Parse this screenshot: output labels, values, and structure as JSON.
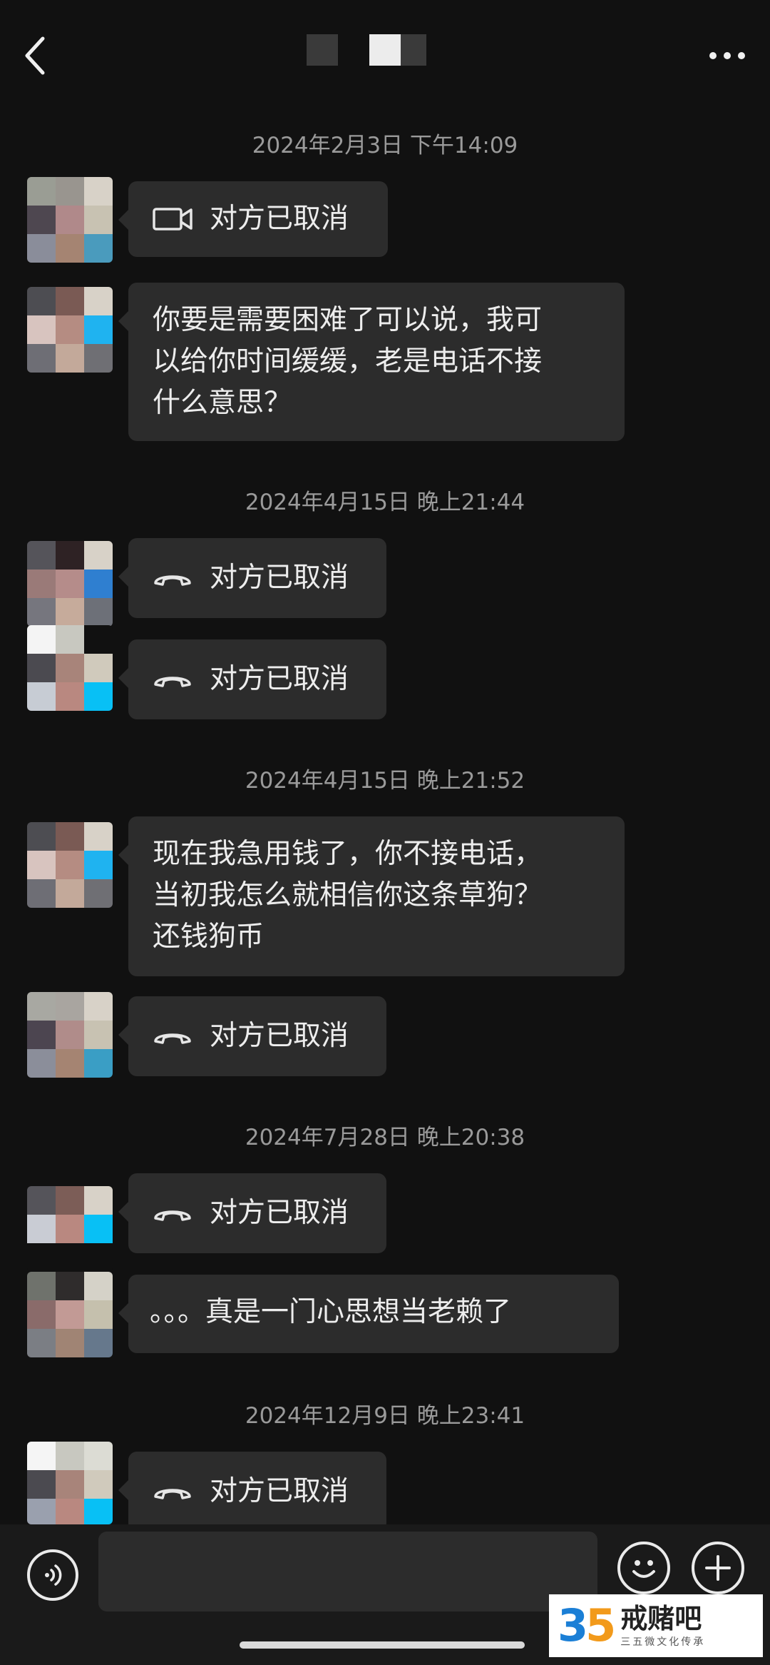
{
  "header": {
    "back_icon": "chevron-left-icon",
    "more_icon": "more-dots-icon"
  },
  "messages": [
    {
      "type": "timestamp",
      "text": "2024年2月3日 下午14:09"
    },
    {
      "type": "call",
      "icon": "video-camera-icon",
      "text": "对方已取消"
    },
    {
      "type": "text",
      "lines": [
        "你要是需要困难了可以说，我可",
        "以给你时间缓缓，老是电话不接",
        "什么意思？"
      ]
    },
    {
      "type": "timestamp",
      "text": "2024年4月15日 晚上21:44"
    },
    {
      "type": "call",
      "icon": "phone-hangup-icon",
      "text": "对方已取消"
    },
    {
      "type": "call",
      "icon": "phone-hangup-icon",
      "text": "对方已取消"
    },
    {
      "type": "timestamp",
      "text": "2024年4月15日 晚上21:52"
    },
    {
      "type": "text",
      "lines": [
        "现在我急用钱了，你不接电话，",
        "当初我怎么就相信你这条草狗？",
        "还钱狗币"
      ]
    },
    {
      "type": "call",
      "icon": "phone-hangup-icon",
      "text": "对方已取消"
    },
    {
      "type": "timestamp",
      "text": "2024年7月28日 晚上20:38"
    },
    {
      "type": "call",
      "icon": "phone-hangup-icon",
      "text": "对方已取消"
    },
    {
      "type": "text",
      "lines": [
        "。。。真是一门心思想当老赖了"
      ]
    },
    {
      "type": "timestamp",
      "text": "2024年12月9日 晚上23:41"
    },
    {
      "type": "call",
      "icon": "phone-hangup-icon",
      "text": "对方已取消"
    }
  ],
  "input_bar": {
    "voice_icon": "voice-icon",
    "input_placeholder": "",
    "emoji_icon": "emoji-icon",
    "plus_icon": "plus-icon"
  },
  "watermark": {
    "logo_number": "35",
    "title": "戒赌吧",
    "subtitle": "三五微文化传承"
  }
}
